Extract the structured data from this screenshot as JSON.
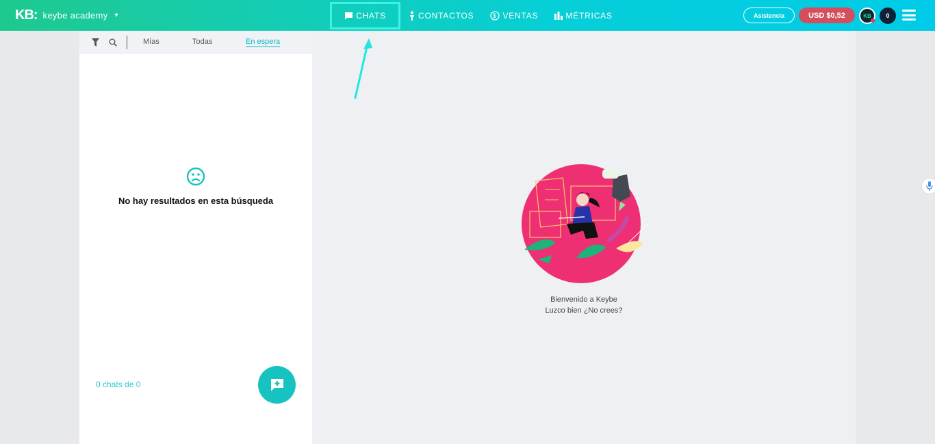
{
  "brand": {
    "logo": "KB:",
    "name": "keybe academy"
  },
  "nav": [
    {
      "label": "CHATS",
      "icon": "chat-icon",
      "active": true
    },
    {
      "label": "CONTACTOS",
      "icon": "person-icon"
    },
    {
      "label": "VENTAS",
      "icon": "dollar-icon"
    },
    {
      "label": "MÉTRICAS",
      "icon": "bar-chart-icon"
    }
  ],
  "header": {
    "assist_label": "Asistencia",
    "balance": "USD $0,52",
    "avatar_initials": "KB",
    "notification_count": "0"
  },
  "chat_list": {
    "tabs": [
      "Mías",
      "Todas",
      "En espera"
    ],
    "active_tab": "En espera",
    "empty_message": "No hay resultados en esta búsqueda",
    "count_label": "0 chats de 0"
  },
  "welcome": {
    "line1": "Bienvenido a Keybe",
    "line2": "Luzco bien ¿No crees?"
  },
  "colors": {
    "accent": "#16c3c0",
    "balance_bg": "#d44f5b",
    "illustration_circle": "#ef2f73"
  }
}
